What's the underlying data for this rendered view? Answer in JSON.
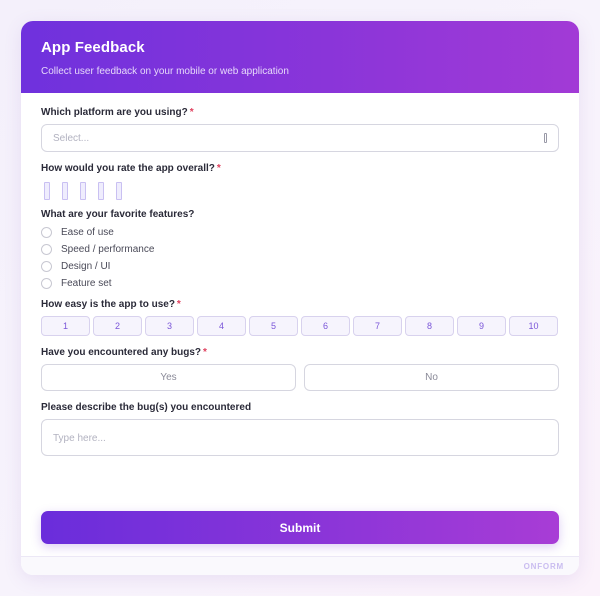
{
  "header": {
    "title": "App Feedback",
    "subtitle": "Collect user feedback on your mobile or web application"
  },
  "q_platform": {
    "label": "Which platform are you using?",
    "required_mark": "*",
    "placeholder": "Select..."
  },
  "q_rating": {
    "label": "How would you rate the app overall?",
    "required_mark": "*",
    "star_count": 5
  },
  "q_features": {
    "label": "What are your favorite features?",
    "options": [
      "Ease of use",
      "Speed / performance",
      "Design / UI",
      "Feature set"
    ]
  },
  "q_ease": {
    "label": "How easy is the app to use?",
    "required_mark": "*",
    "scale": [
      "1",
      "2",
      "3",
      "4",
      "5",
      "6",
      "7",
      "8",
      "9",
      "10"
    ]
  },
  "q_bugs": {
    "label": "Have you encountered any bugs?",
    "required_mark": "*",
    "yes_label": "Yes",
    "no_label": "No"
  },
  "q_bug_desc": {
    "label": "Please describe the bug(s) you encountered",
    "placeholder": "Type here..."
  },
  "submit_label": "Submit",
  "footer": {
    "brand": "ONFORM"
  },
  "colors": {
    "accent": "#7b33db",
    "accent_end": "#a83cd6",
    "required": "#e0405e",
    "scale_text": "#7a55d8"
  }
}
